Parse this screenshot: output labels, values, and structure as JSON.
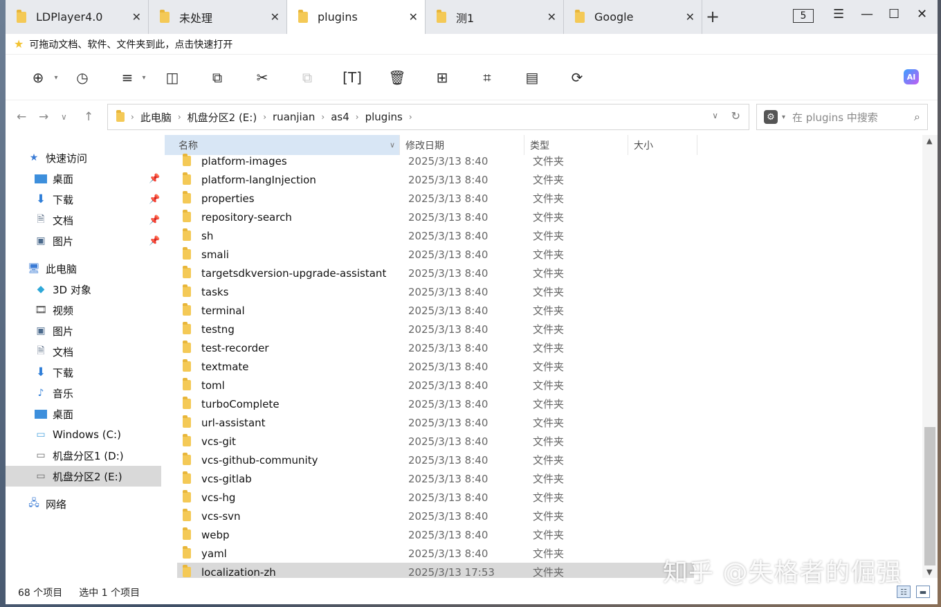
{
  "tabs": [
    {
      "label": "LDPlayer4.0",
      "active": false
    },
    {
      "label": "未处理",
      "active": false
    },
    {
      "label": "plugins",
      "active": true
    },
    {
      "label": "测1",
      "active": false
    },
    {
      "label": "Google",
      "active": false
    }
  ],
  "tab_count": "5",
  "hint_text": "可拖动文档、软件、文件夹到此，点击快速打开",
  "address": {
    "crumbs": [
      "此电脑",
      "机盘分区2 (E:)",
      "ruanjian",
      "as4",
      "plugins"
    ]
  },
  "search": {
    "placeholder": "在 plugins 中搜索"
  },
  "columns": {
    "name": "名称",
    "date": "修改日期",
    "type": "类型",
    "size": "大小"
  },
  "sidebar": {
    "quick_access": "快速访问",
    "quick_items": [
      "桌面",
      "下载",
      "文档",
      "图片"
    ],
    "this_pc": "此电脑",
    "pc_items": [
      "3D 对象",
      "视频",
      "图片",
      "文档",
      "下载",
      "音乐",
      "桌面",
      "Windows (C:)",
      "机盘分区1 (D:)",
      "机盘分区2 (E:)"
    ],
    "network": "网络"
  },
  "files": [
    {
      "name": "platform-images",
      "date": "2025/3/13 8:40",
      "type": "文件夹"
    },
    {
      "name": "platform-langInjection",
      "date": "2025/3/13 8:40",
      "type": "文件夹"
    },
    {
      "name": "properties",
      "date": "2025/3/13 8:40",
      "type": "文件夹"
    },
    {
      "name": "repository-search",
      "date": "2025/3/13 8:40",
      "type": "文件夹"
    },
    {
      "name": "sh",
      "date": "2025/3/13 8:40",
      "type": "文件夹"
    },
    {
      "name": "smali",
      "date": "2025/3/13 8:40",
      "type": "文件夹"
    },
    {
      "name": "targetsdkversion-upgrade-assistant",
      "date": "2025/3/13 8:40",
      "type": "文件夹"
    },
    {
      "name": "tasks",
      "date": "2025/3/13 8:40",
      "type": "文件夹"
    },
    {
      "name": "terminal",
      "date": "2025/3/13 8:40",
      "type": "文件夹"
    },
    {
      "name": "testng",
      "date": "2025/3/13 8:40",
      "type": "文件夹"
    },
    {
      "name": "test-recorder",
      "date": "2025/3/13 8:40",
      "type": "文件夹"
    },
    {
      "name": "textmate",
      "date": "2025/3/13 8:40",
      "type": "文件夹"
    },
    {
      "name": "toml",
      "date": "2025/3/13 8:40",
      "type": "文件夹"
    },
    {
      "name": "turboComplete",
      "date": "2025/3/13 8:40",
      "type": "文件夹"
    },
    {
      "name": "url-assistant",
      "date": "2025/3/13 8:40",
      "type": "文件夹"
    },
    {
      "name": "vcs-git",
      "date": "2025/3/13 8:40",
      "type": "文件夹"
    },
    {
      "name": "vcs-github-community",
      "date": "2025/3/13 8:40",
      "type": "文件夹"
    },
    {
      "name": "vcs-gitlab",
      "date": "2025/3/13 8:40",
      "type": "文件夹"
    },
    {
      "name": "vcs-hg",
      "date": "2025/3/13 8:40",
      "type": "文件夹"
    },
    {
      "name": "vcs-svn",
      "date": "2025/3/13 8:40",
      "type": "文件夹"
    },
    {
      "name": "webp",
      "date": "2025/3/13 8:40",
      "type": "文件夹"
    },
    {
      "name": "yaml",
      "date": "2025/3/13 8:40",
      "type": "文件夹"
    },
    {
      "name": "localization-zh",
      "date": "2025/3/13 17:53",
      "type": "文件夹",
      "selected": true
    }
  ],
  "status": {
    "item_count": "68 个项目",
    "selection": "选中 1 个项目"
  },
  "watermark": "知乎 @失格者的倔强",
  "ai_label": "AI",
  "colors": {
    "folder": "#f4c956",
    "selection": "#d9d9d9",
    "sorted_header": "#d8e6f5",
    "accent": "#3b7fd9"
  }
}
